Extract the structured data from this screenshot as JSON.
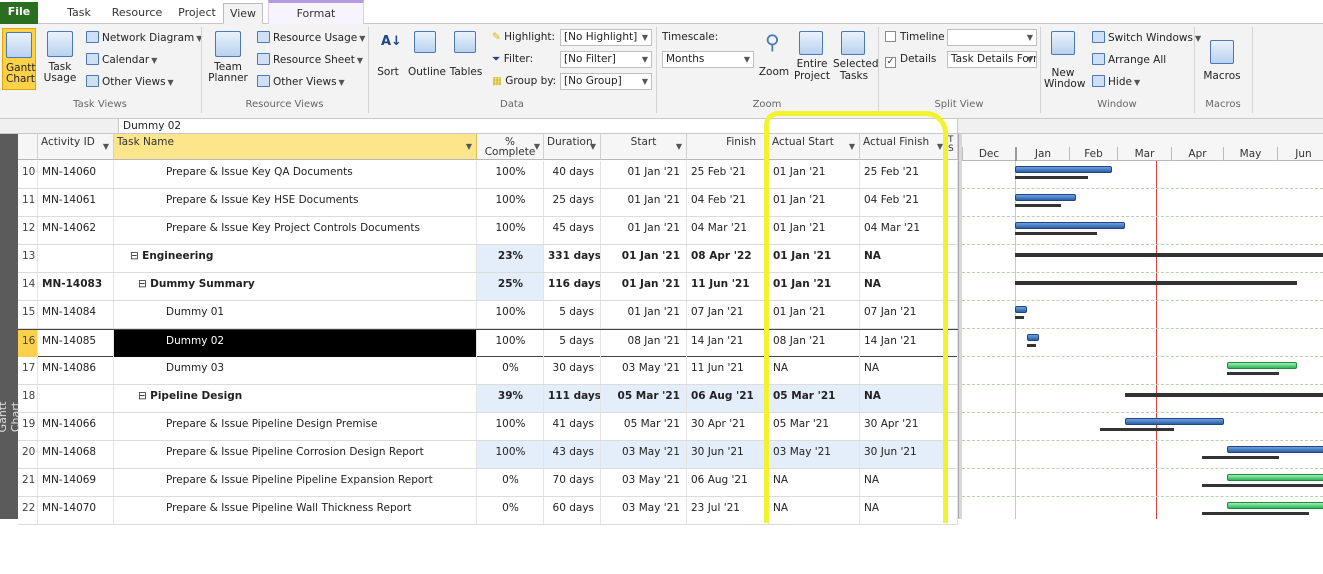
{
  "tabs": [
    "File",
    "Task",
    "Resource",
    "Project",
    "View",
    "Format"
  ],
  "ribbon": {
    "task_views": {
      "gantt_chart": "Gantt Chart",
      "task_usage": "Task Usage",
      "network_diagram": "Network Diagram",
      "calendar": "Calendar",
      "other_views": "Other Views",
      "label": "Task Views"
    },
    "resource_views": {
      "team_planner": "Team Planner",
      "resource_usage": "Resource Usage",
      "resource_sheet": "Resource Sheet",
      "other_views": "Other Views",
      "label": "Resource Views"
    },
    "data": {
      "sort": "Sort",
      "outline": "Outline",
      "tables": "Tables",
      "highlight_label": "Highlight:",
      "highlight_value": "[No Highlight]",
      "filter_label": "Filter:",
      "filter_value": "[No Filter]",
      "group_label": "Group by:",
      "group_value": "[No Group]",
      "label": "Data"
    },
    "zoom": {
      "timescale_label": "Timescale:",
      "timescale_value": "Months",
      "zoom": "Zoom",
      "entire_project": "Entire Project",
      "selected_tasks": "Selected Tasks",
      "label": "Zoom"
    },
    "split_view": {
      "timeline": "Timeline",
      "details": "Details",
      "details_value": "Task Details Forr",
      "label": "Split View"
    },
    "window": {
      "new_window": "New Window",
      "switch_windows": "Switch Windows",
      "arrange_all": "Arrange All",
      "hide": "Hide",
      "label": "Window"
    },
    "macros": {
      "macros": "Macros",
      "label": "Macros"
    }
  },
  "entry_bar": {
    "value": "Dummy 02"
  },
  "side_label": "Gantt Chart",
  "columns": [
    "Activity ID",
    "Task Name",
    "% Complete",
    "Duration",
    "Start",
    "Finish",
    "Actual Start",
    "Actual Finish",
    "T S"
  ],
  "rows": [
    {
      "n": "10",
      "id": "MN-14060",
      "name": "Prepare & Issue Key QA Documents",
      "pct": "100%",
      "dur": "40 days",
      "start": "01 Jan '21",
      "finish": "25 Feb '21",
      "astart": "01 Jan '21",
      "afinish": "25 Feb '21"
    },
    {
      "n": "11",
      "id": "MN-14061",
      "name": "Prepare & Issue Key HSE Documents",
      "pct": "100%",
      "dur": "25 days",
      "start": "01 Jan '21",
      "finish": "04 Feb '21",
      "astart": "01 Jan '21",
      "afinish": "04 Feb '21"
    },
    {
      "n": "12",
      "id": "MN-14062",
      "name": "Prepare & Issue Key Project Controls Documents",
      "pct": "100%",
      "dur": "45 days",
      "start": "01 Jan '21",
      "finish": "04 Mar '21",
      "astart": "01 Jan '21",
      "afinish": "04 Mar '21"
    },
    {
      "n": "13",
      "id": "",
      "name": "Engineering",
      "pct": "23%",
      "dur": "331 days",
      "start": "01 Jan '21",
      "finish": "08 Apr '22",
      "astart": "01 Jan '21",
      "afinish": "NA"
    },
    {
      "n": "14",
      "id": "MN-14083",
      "name": "Dummy Summary",
      "pct": "25%",
      "dur": "116 days",
      "start": "01 Jan '21",
      "finish": "11 Jun '21",
      "astart": "01 Jan '21",
      "afinish": "NA"
    },
    {
      "n": "15",
      "id": "MN-14084",
      "name": "Dummy 01",
      "pct": "100%",
      "dur": "5 days",
      "start": "01 Jan '21",
      "finish": "07 Jan '21",
      "astart": "01 Jan '21",
      "afinish": "07 Jan '21"
    },
    {
      "n": "16",
      "id": "MN-14085",
      "name": "Dummy 02",
      "pct": "100%",
      "dur": "5 days",
      "start": "08 Jan '21",
      "finish": "14 Jan '21",
      "astart": "08 Jan '21",
      "afinish": "14 Jan '21"
    },
    {
      "n": "17",
      "id": "MN-14086",
      "name": "Dummy 03",
      "pct": "0%",
      "dur": "30 days",
      "start": "03 May '21",
      "finish": "11 Jun '21",
      "astart": "NA",
      "afinish": "NA"
    },
    {
      "n": "18",
      "id": "",
      "name": "Pipeline Design",
      "pct": "39%",
      "dur": "111 days",
      "start": "05 Mar '21",
      "finish": "06 Aug '21",
      "astart": "05 Mar '21",
      "afinish": "NA"
    },
    {
      "n": "19",
      "id": "MN-14066",
      "name": "Prepare & Issue Pipeline Design Premise",
      "pct": "100%",
      "dur": "41 days",
      "start": "05 Mar '21",
      "finish": "30 Apr '21",
      "astart": "05 Mar '21",
      "afinish": "30 Apr '21"
    },
    {
      "n": "20",
      "id": "MN-14068",
      "name": "Prepare & Issue Pipeline Corrosion Design Report",
      "pct": "100%",
      "dur": "43 days",
      "start": "03 May '21",
      "finish": "30 Jun '21",
      "astart": "03 May '21",
      "afinish": "30 Jun '21"
    },
    {
      "n": "21",
      "id": "MN-14069",
      "name": "Prepare & Issue Pipeline Pipeline Expansion Report",
      "pct": "0%",
      "dur": "70 days",
      "start": "03 May '21",
      "finish": "06 Aug '21",
      "astart": "NA",
      "afinish": "NA"
    },
    {
      "n": "22",
      "id": "MN-14070",
      "name": "Prepare & Issue Pipeline Wall Thickness Report",
      "pct": "0%",
      "dur": "60 days",
      "start": "03 May '21",
      "finish": "23 Jul '21",
      "astart": "NA",
      "afinish": "NA"
    }
  ],
  "gantt": {
    "months": [
      "Dec",
      "Jan",
      "Feb",
      "Mar",
      "Apr",
      "May",
      "Jun"
    ]
  }
}
